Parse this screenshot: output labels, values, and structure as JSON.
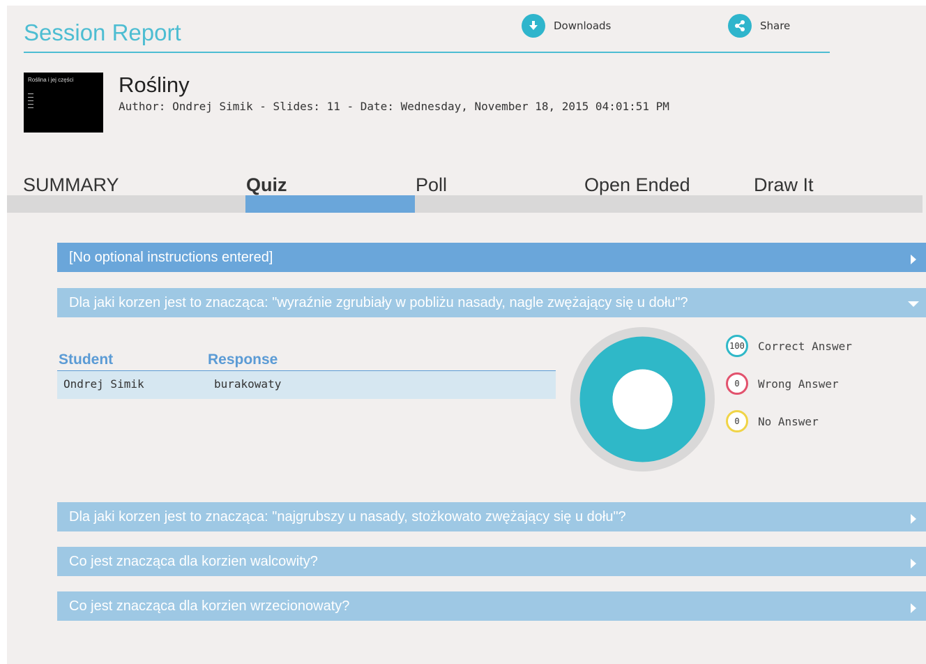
{
  "header": {
    "title": "Session Report",
    "downloads_label": "Downloads",
    "share_label": "Share",
    "accent_color": "#4dbdd2"
  },
  "presentation": {
    "thumbnail_title": "Roślina i jej części",
    "name": "Rośliny",
    "meta": "Author: Ondrej Simik - Slides: 11 - Date: Wednesday, November 18, 2015 04:01:51 PM"
  },
  "tabs": [
    {
      "label": "SUMMARY",
      "active": false
    },
    {
      "label": "Quiz",
      "active": true
    },
    {
      "label": "Poll",
      "active": false
    },
    {
      "label": "Open Ended",
      "active": false
    },
    {
      "label": "Draw It",
      "active": false
    }
  ],
  "accordion": [
    {
      "label": "[No optional instructions entered]",
      "expanded": false
    },
    {
      "label": "Dla jaki korzen jest to znacząca: \"wyraźnie zgrubiały w pobliżu nasady, nagle zwężający się u dołu\"?",
      "expanded": true
    },
    {
      "label": "Dla jaki korzen jest to znacząca: \"najgrubszy u nasady, stożkowato zwężający się u dołu\"?",
      "expanded": false
    },
    {
      "label": "Co jest znacząca dla korzien walcowity?",
      "expanded": false
    },
    {
      "label": "Co jest znacząca dla korzien wrzecionowaty?",
      "expanded": false
    }
  ],
  "responses": {
    "columns": [
      "Student",
      "Response"
    ],
    "rows": [
      {
        "student": "Ondrej Simik",
        "response": "burakowaty"
      }
    ]
  },
  "results": {
    "correct": {
      "label": "Correct Answer",
      "value": "100",
      "color": "#2fb8c8"
    },
    "wrong": {
      "label": "Wrong Answer",
      "value": "0",
      "color": "#e2526d"
    },
    "none": {
      "label": "No Answer",
      "value": "0",
      "color": "#f0d447"
    }
  },
  "icons": {
    "downloads": "download-arrow-icon",
    "share": "share-icon"
  }
}
